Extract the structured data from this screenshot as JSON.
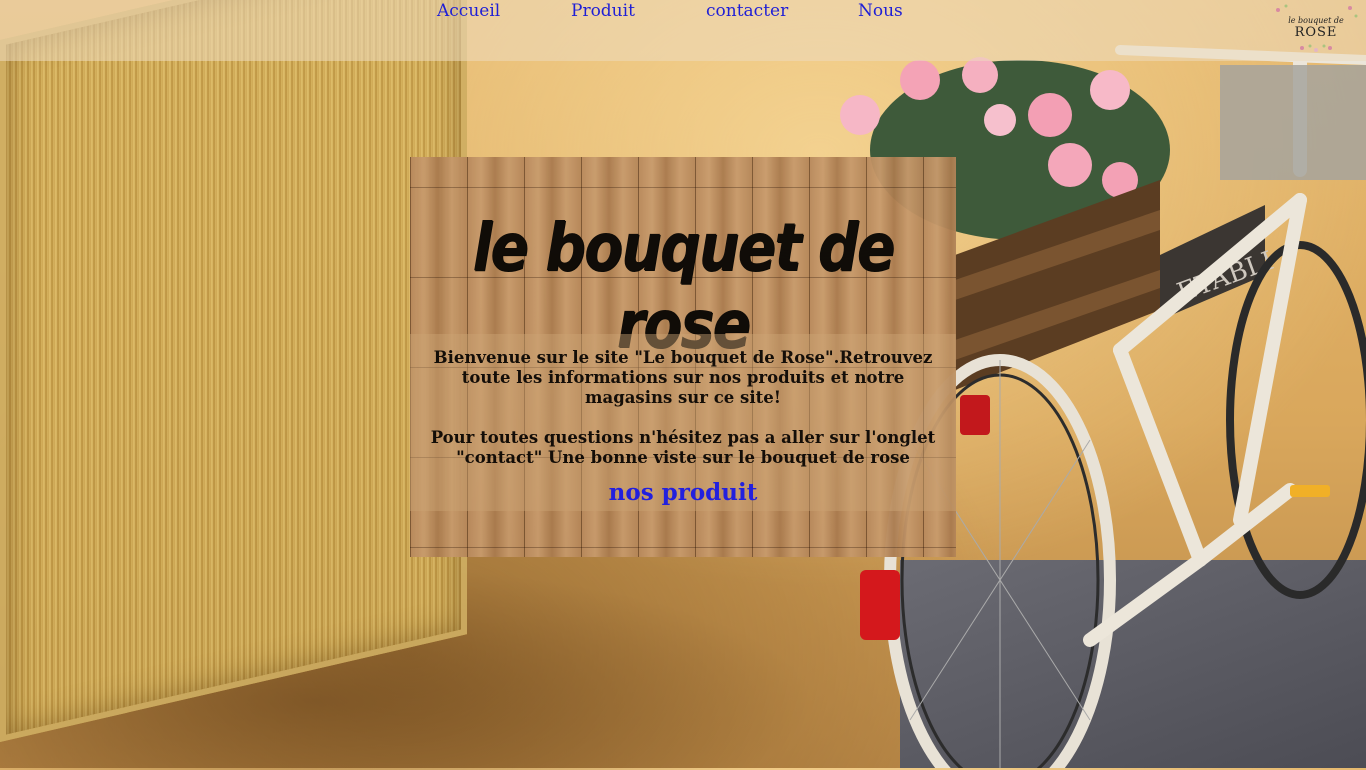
{
  "nav": {
    "items": [
      {
        "label": "Accueil"
      },
      {
        "label": "Produit"
      },
      {
        "label": "contacter"
      },
      {
        "label": "Nous"
      }
    ],
    "logo": {
      "top_text": "le bouquet de",
      "main_text": "ROSE"
    }
  },
  "content": {
    "title": "le bouquet de rose",
    "welcome": "Bienvenue sur le site \"Le bouquet de Rose\".Retrouvez toute les informations sur nos produits et notre magasins sur ce site!",
    "contact": "Pour toutes questions n'hésitez pas a aller sur l'onglet \"contact\" Une bonne viste sur le bouquet de rose",
    "products_link": "nos produit"
  },
  "background": {
    "bike_sign_text": "ETABLI"
  },
  "colors": {
    "link": "#1f1fd6",
    "title": "#050302",
    "wall": "#d9a75c",
    "wood": "#b7885c"
  }
}
